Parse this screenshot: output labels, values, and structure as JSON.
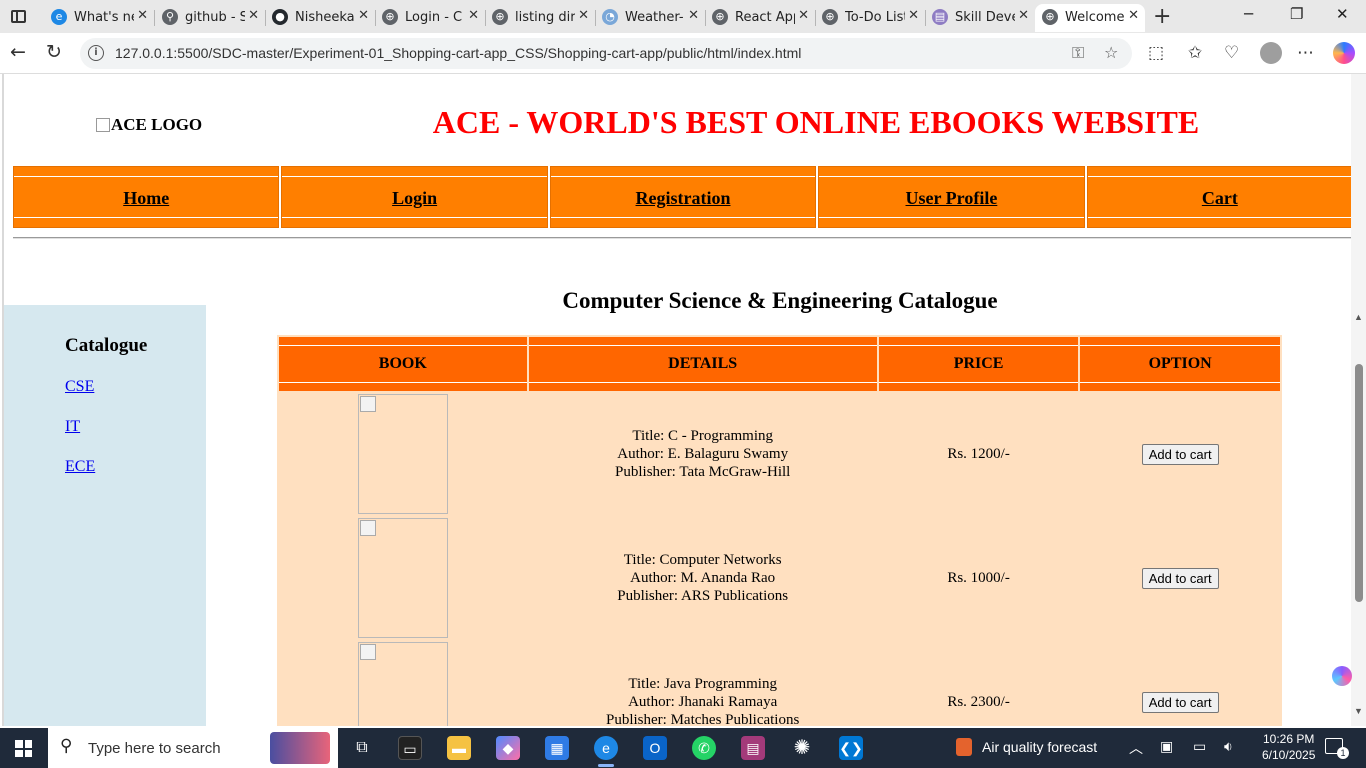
{
  "browser": {
    "tabs": [
      {
        "label": "What's new",
        "fav": "e",
        "color": "#1e88e5"
      },
      {
        "label": "github - S",
        "fav": "⚲",
        "color": "#5f6368"
      },
      {
        "label": "Nisheeka",
        "fav": "●",
        "color": "#24292e"
      },
      {
        "label": "Login - C",
        "fav": "⊕",
        "color": "#5f6368"
      },
      {
        "label": "listing dir",
        "fav": "⊕",
        "color": "#5f6368"
      },
      {
        "label": "Weather-",
        "fav": "◔",
        "color": "#7aa7d8"
      },
      {
        "label": "React App",
        "fav": "⊕",
        "color": "#5f6368"
      },
      {
        "label": "To-Do List",
        "fav": "⊕",
        "color": "#5f6368"
      },
      {
        "label": "Skill Deve",
        "fav": "▤",
        "color": "#8e7cc3"
      },
      {
        "label": "Welcome",
        "fav": "⊕",
        "color": "#5f6368"
      }
    ],
    "url": "127.0.0.1:5500/SDC-master/Experiment-01_Shopping-cart-app_CSS/Shopping-cart-app/public/html/index.html"
  },
  "site": {
    "logo_alt": "ACE LOGO",
    "title": "ACE - WORLD'S BEST ONLINE EBOOKS WEBSITE",
    "nav": [
      "Home",
      "Login",
      "Registration",
      "User Profile",
      "Cart"
    ]
  },
  "sidebar": {
    "title": "Catalogue",
    "links": [
      "CSE",
      "IT",
      "ECE"
    ]
  },
  "catalogue": {
    "heading": "Computer Science & Engineering Catalogue",
    "columns": [
      "BOOK",
      "DETAILS",
      "PRICE",
      "OPTION"
    ],
    "button_label": "Add to cart",
    "books": [
      {
        "title": "Title: C - Programming",
        "author": "Author: E. Balaguru Swamy",
        "publisher": "Publisher: Tata McGraw-Hill",
        "price": "Rs. 1200/-"
      },
      {
        "title": "Title: Computer Networks",
        "author": "Author: M. Ananda Rao",
        "publisher": "Publisher: ARS Publications",
        "price": "Rs. 1000/-"
      },
      {
        "title": "Title: Java Programming",
        "author": "Author: Jhanaki Ramaya",
        "publisher": "Publisher: Matches Publications",
        "price": "Rs. 2300/-"
      }
    ]
  },
  "taskbar": {
    "search_placeholder": "Type here to search",
    "weather": "Air quality forecast",
    "time": "10:26 PM",
    "date": "6/10/2025",
    "notifications": "1"
  }
}
